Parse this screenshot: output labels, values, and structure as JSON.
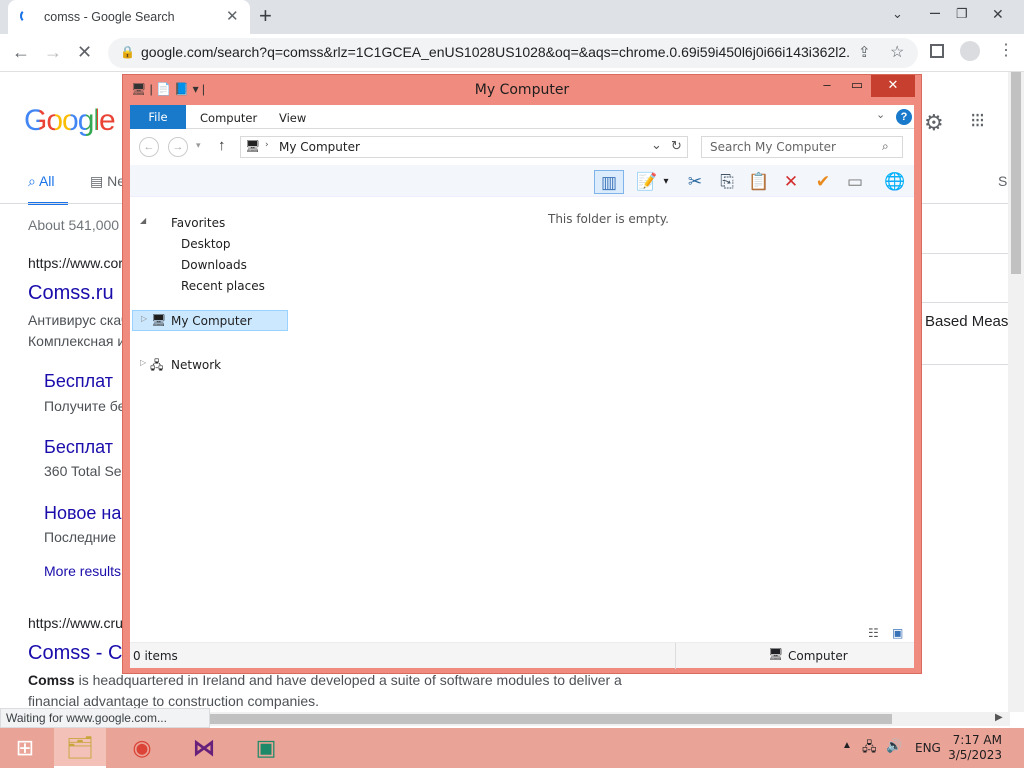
{
  "browser": {
    "tab_title": "comss - Google Search",
    "tab_close": "✕",
    "new_tab": "+",
    "url": "google.com/search?q=comss&rlz=1C1GCEA_enUS1028US1028&oq=&aqs=chrome.0.69i59i450l6j0i66i143i362l2...",
    "status_text": "Waiting for www.google.com..."
  },
  "google": {
    "logo": "Google",
    "tabs": [
      {
        "label": "All"
      },
      {
        "label": "Ne"
      }
    ],
    "right_tab": "S",
    "results_count": "About 541,000",
    "result1": {
      "cite": "https://www.cor",
      "title": "Comss.ru",
      "snippet1": "Антивирус скач",
      "snippet2": "Комплексная и",
      "sublinks": [
        {
          "title": "Бесплат",
          "desc": "Получите бе"
        },
        {
          "title": "Бесплат",
          "desc": "360 Total Se"
        },
        {
          "title": "Новое на",
          "desc": "Последние"
        }
      ],
      "more": "More results"
    },
    "right_snippet": "Based Meas",
    "result2": {
      "cite": "https://www.cru",
      "title": "Comss - C",
      "snippet_bold": "Comss",
      "snippet_rest": " is headquartered in Ireland and have developed a suite of software modules to deliver a",
      "snippet2": "financial advantage to construction companies."
    }
  },
  "explorer": {
    "title": "My Computer",
    "ribbon_tabs": [
      "File",
      "Computer",
      "View"
    ],
    "help": "?",
    "address": "My Computer",
    "search_placeholder": "Search My Computer",
    "nav": {
      "favorites": "Favorites",
      "fav_items": [
        "Desktop",
        "Downloads",
        "Recent places"
      ],
      "my_computer": "My Computer",
      "network": "Network"
    },
    "empty_message": "This folder is empty.",
    "item_count": "0 items",
    "status_location": "Computer"
  },
  "taskbar": {
    "language": "ENG",
    "time": "7:17 AM",
    "date": "3/5/2023"
  }
}
